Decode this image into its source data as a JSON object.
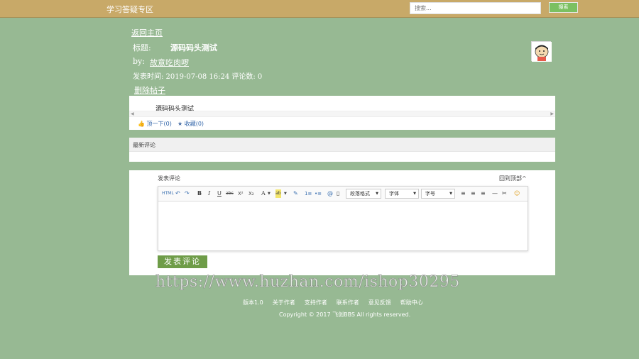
{
  "header": {
    "site_title": "学习答疑专区",
    "search_placeholder": "搜索...",
    "search_button": "搜索",
    "bar_color": "#c8a968"
  },
  "post": {
    "back_home": "返回主页",
    "title_label": "标题:",
    "title": "源码码头测试",
    "by_label": "by:",
    "author": "故意吃肉啰",
    "time_row": "发表时间: 2019-07-08 16:24 评论数: 0",
    "delete": "删除帖子",
    "content": "源码码头测试",
    "like": "顶一下(0)",
    "favorite": "收藏(0)"
  },
  "comments": {
    "header": "最新评论"
  },
  "compose": {
    "label": "发表评论",
    "back_top": "回到顶部^",
    "toolbar": {
      "html": "HTML",
      "undo": "↶",
      "redo": "↷",
      "bold": "B",
      "italic": "I",
      "underline": "U",
      "strike": "abc",
      "sup": "X²",
      "sub": "X₂",
      "font_color": "A",
      "highlight": "ab",
      "brush": "✎",
      "ol": "1≡",
      "ul": "•≡",
      "link": "@",
      "image": "▯",
      "paragraph": "段落格式",
      "font_family": "字体",
      "font_size": "字号",
      "align_left": "≡",
      "align_center": "≡",
      "align_right": "≡",
      "hr": "—",
      "clear_format": "✂",
      "emoji": "☺"
    },
    "submit": "发表评论",
    "submit_color": "#6e9c48"
  },
  "watermark": "https://www.huzhan.com/ishop30295",
  "footer": {
    "links": [
      "版本1.0",
      "关于作者",
      "支持作者",
      "联系作者",
      "意见反馈",
      "帮助中心"
    ],
    "copyright": "Copyright © 2017 飞创BBS All rights reserved."
  },
  "colors": {
    "background": "#97b993",
    "accent_green": "#7bc061",
    "link_blue": "#3366aa"
  }
}
